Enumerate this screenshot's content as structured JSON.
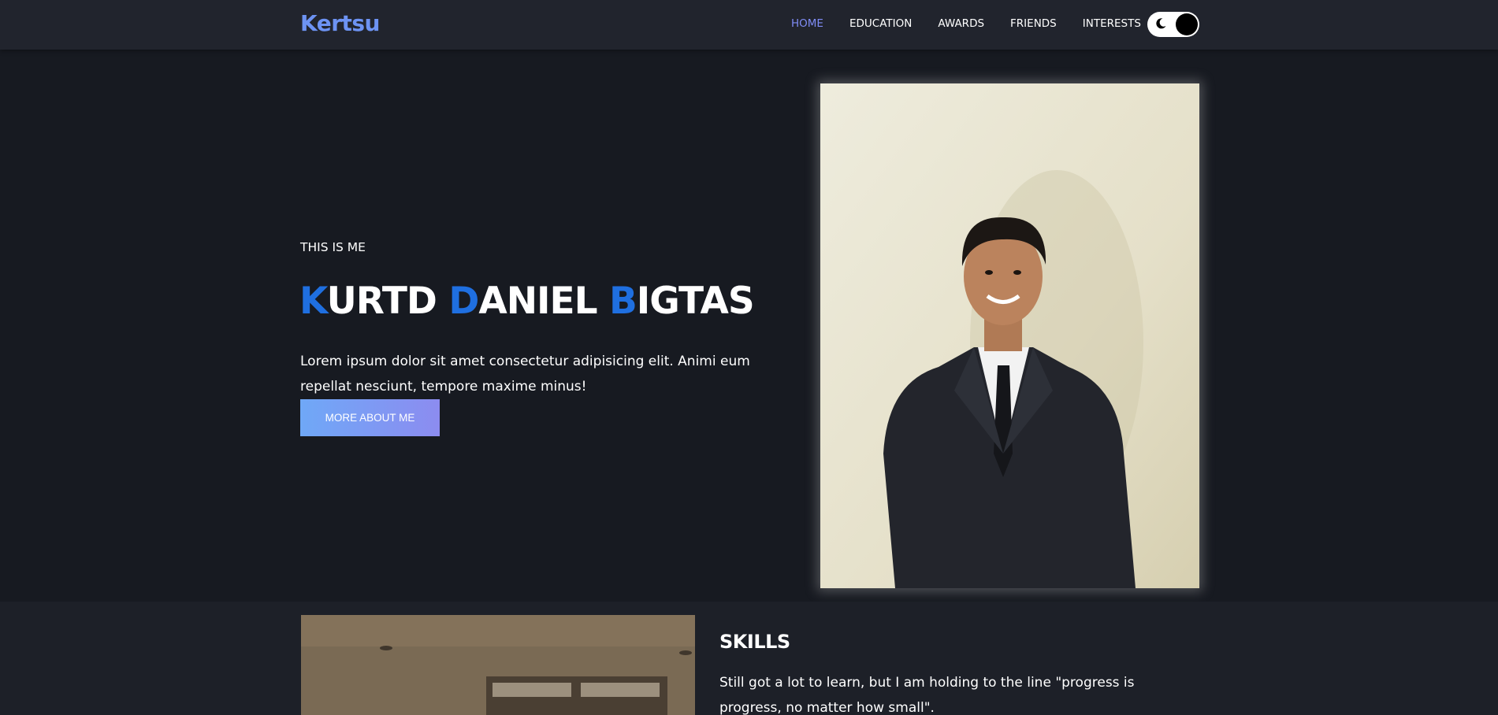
{
  "navbar": {
    "logo": "Kertsu",
    "links": [
      {
        "label": "HOME",
        "active": true
      },
      {
        "label": "EDUCATION",
        "active": false
      },
      {
        "label": "AWARDS",
        "active": false
      },
      {
        "label": "FRIENDS",
        "active": false
      },
      {
        "label": "INTERESTS",
        "active": false
      }
    ],
    "theme_toggle": {
      "icon": "moon-icon",
      "state": "dark"
    }
  },
  "hero": {
    "intro": "THIS IS ME",
    "name_parts": [
      {
        "cap": "K",
        "rest": "URTD"
      },
      {
        "cap": "D",
        "rest": "ANIEL"
      },
      {
        "cap": "B",
        "rest": "IGTAS"
      }
    ],
    "description": "Lorem ipsum dolor sit amet consectetur adipisicing elit. Animi eum repellat nesciunt, tempore maxime minus!",
    "cta_label": "MORE ABOUT ME"
  },
  "skills": {
    "title": "SKILLS",
    "description": "Still got a lot to learn, but I am holding to the line \"progress is progress, no matter how small\"."
  },
  "colors": {
    "accent": "#6d93f3",
    "name_capital": "#1f6fe0",
    "nav_active": "#7f8cf5",
    "background": "#171a21"
  }
}
